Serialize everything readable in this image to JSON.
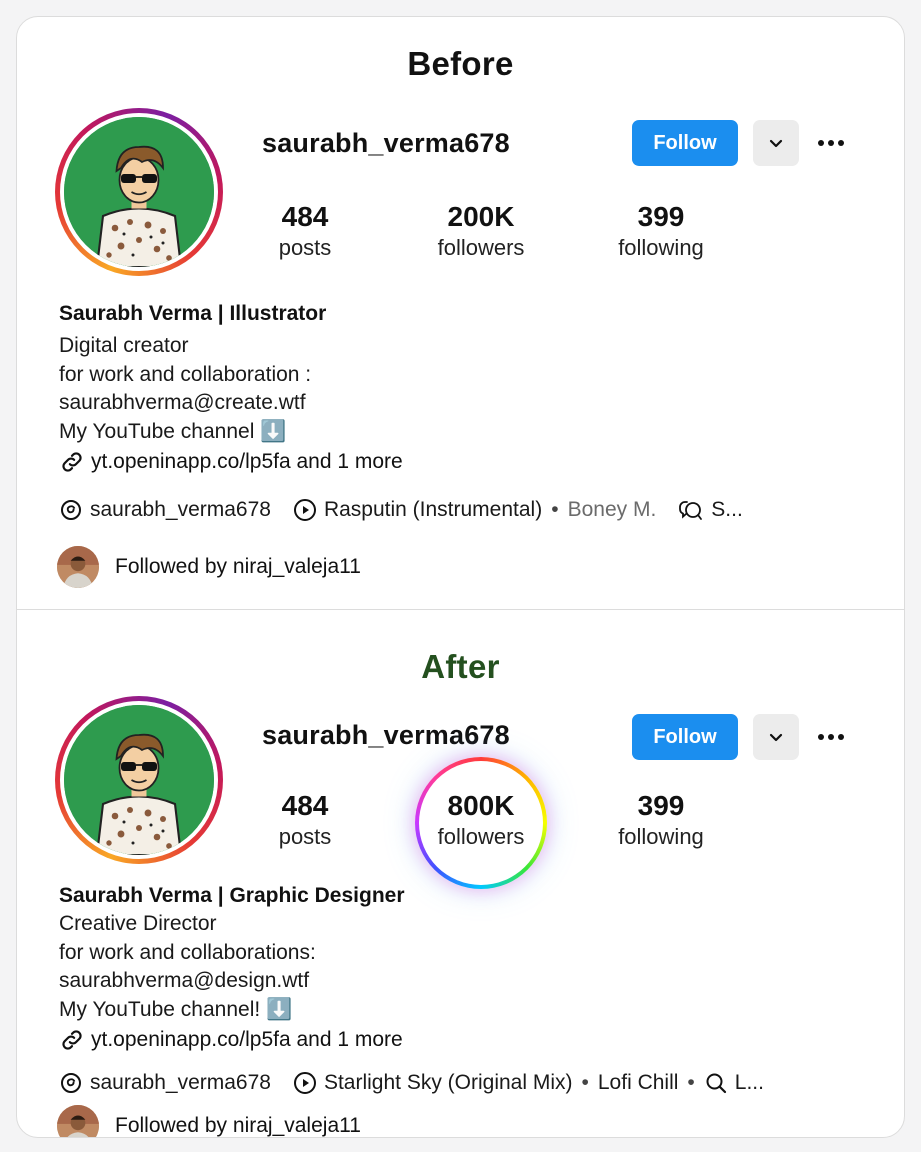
{
  "before": {
    "title": "Before",
    "username": "saurabh_verma678",
    "follow_label": "Follow",
    "stats": {
      "posts": {
        "value": "484",
        "label": "posts"
      },
      "followers": {
        "value": "200K",
        "label": "followers"
      },
      "following": {
        "value": "399",
        "label": "following"
      }
    },
    "bio": {
      "name": "Saurabh Verma | Illustrator",
      "lines": [
        "Digital creator",
        "for work and collaboration :",
        "saurabhverma@create.wtf",
        "My YouTube channel ⬇️"
      ],
      "link": "yt.openinapp.co/lp5fa and 1 more"
    },
    "meta": {
      "threads": "saurabh_verma678",
      "song": "Rasputin (Instrumental)",
      "sep": "•",
      "artist": "Boney M.",
      "extra": "S..."
    },
    "followed_by": "Followed by niraj_valeja11"
  },
  "after": {
    "title": "After",
    "username": "saurabh_verma678",
    "follow_label": "Follow",
    "stats": {
      "posts": {
        "value": "484",
        "label": "posts"
      },
      "followers": {
        "value": "800K",
        "label": "followers"
      },
      "following": {
        "value": "399",
        "label": "following"
      }
    },
    "bio": {
      "name": "Saurabh Verma | Graphic Designer",
      "lines": [
        "Creative Director",
        "for work and collaborations:",
        "saurabhverma@design.wtf",
        "My YouTube channel! ⬇️"
      ],
      "link": "yt.openinapp.co/lp5fa and 1 more"
    },
    "meta": {
      "threads": "saurabh_verma678",
      "song": "Starlight Sky (Original Mix)",
      "sep": "•",
      "artist": "Lofi Chill",
      "sep2": "•",
      "extra": "L..."
    },
    "followed_by": "Followed by niraj_valeja11"
  },
  "icons": {
    "link": "link-icon",
    "threads": "threads-icon",
    "music": "play-circle-icon",
    "search": "search-icon",
    "chevron": "chevron-down-icon",
    "more": "more-dots-icon"
  },
  "colors": {
    "follow_blue": "#1b8eef",
    "after_title_green": "#24501f",
    "avatar_bg_green": "#2e9b4e"
  }
}
